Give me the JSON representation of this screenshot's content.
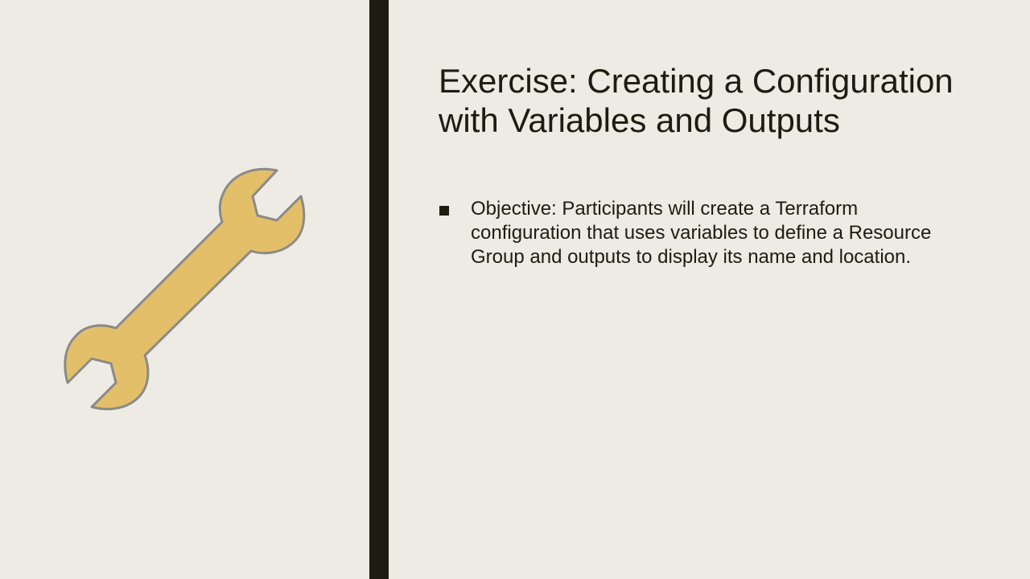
{
  "slide": {
    "title": "Exercise: Creating a Configuration with Variables and Outputs",
    "bullets": [
      "Objective: Participants will create a Terraform configuration that uses variables to define a Resource Group and outputs to display its name and location."
    ],
    "icon": "wrench-icon"
  },
  "colors": {
    "background": "#edebe3",
    "divider": "#1c1d10",
    "text": "#1c1d10",
    "icon_fill": "#e4bf6a",
    "icon_stroke": "#8a8a87"
  }
}
